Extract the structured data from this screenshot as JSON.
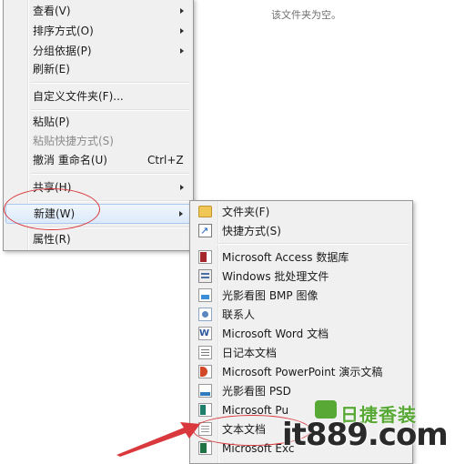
{
  "window": {
    "empty_message": "该文件夹为空。"
  },
  "context_menu": {
    "items": [
      {
        "label": "查看(V)",
        "submenu": true
      },
      {
        "label": "排序方式(O)",
        "submenu": true
      },
      {
        "label": "分组依据(P)",
        "submenu": true
      },
      {
        "label": "刷新(E)"
      },
      {
        "label": "自定义文件夹(F)..."
      },
      {
        "label": "粘贴(P)"
      },
      {
        "label": "粘贴快捷方式(S)",
        "disabled": true
      },
      {
        "label": "撤消 重命名(U)",
        "shortcut": "Ctrl+Z"
      },
      {
        "label": "共享(H)",
        "submenu": true
      },
      {
        "label": "新建(W)",
        "submenu": true,
        "highlighted": true
      },
      {
        "label": "属性(R)"
      }
    ]
  },
  "new_submenu": {
    "items": [
      {
        "label": "文件夹(F)",
        "icon": "folder-icon"
      },
      {
        "label": "快捷方式(S)",
        "icon": "shortcut-icon"
      },
      {
        "label": "Microsoft Access 数据库",
        "icon": "access-icon"
      },
      {
        "label": "Windows 批处理文件",
        "icon": "batch-file-icon"
      },
      {
        "label": "光影看图 BMP 图像",
        "icon": "bmp-image-icon"
      },
      {
        "label": "联系人",
        "icon": "contact-icon"
      },
      {
        "label": "Microsoft Word 文档",
        "icon": "word-icon"
      },
      {
        "label": "日记本文档",
        "icon": "journal-icon"
      },
      {
        "label": "Microsoft PowerPoint 演示文稿",
        "icon": "powerpoint-icon"
      },
      {
        "label": "光影看图 PSD",
        "icon": "psd-image-icon"
      },
      {
        "label": "Microsoft Pu",
        "icon": "publisher-icon"
      },
      {
        "label": "文本文档",
        "icon": "text-document-icon"
      },
      {
        "label": "Microsoft Exc",
        "icon": "excel-icon"
      }
    ]
  },
  "watermark": {
    "brand": "日捷香装",
    "domain": "it889.com"
  },
  "colors": {
    "annotation": "#d9393d",
    "watermark_green": "#57a834",
    "highlight_border": "#a8c8ef"
  }
}
